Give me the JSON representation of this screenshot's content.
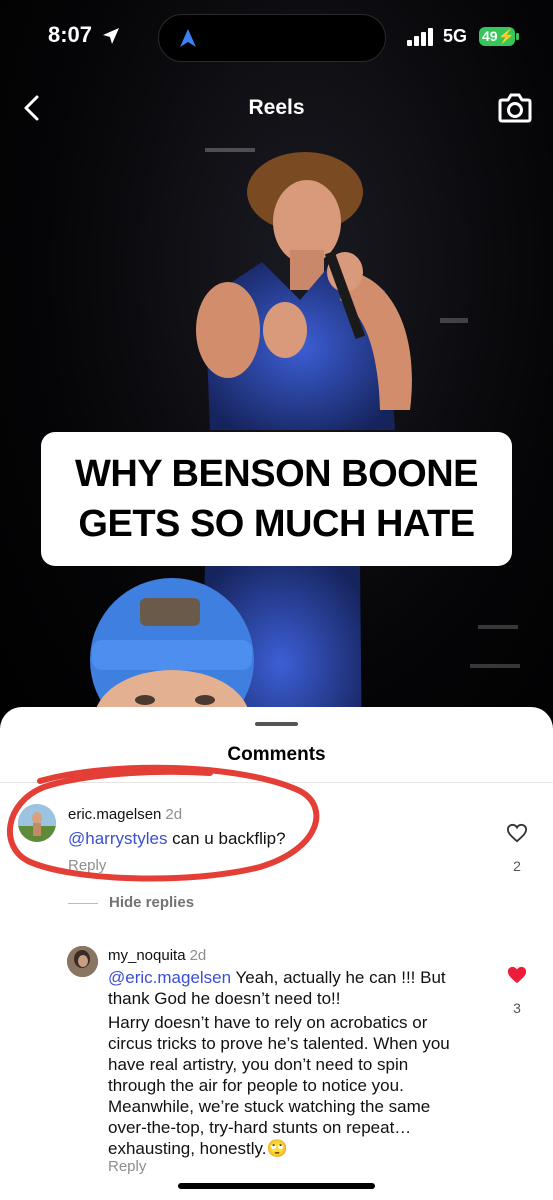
{
  "status_bar": {
    "time": "8:07",
    "network": "5G",
    "battery": "49"
  },
  "header": {
    "title": "Reels"
  },
  "video": {
    "caption_line1": "WHY BENSON BOONE",
    "caption_line2": "GETS SO MUCH HATE"
  },
  "comments_sheet": {
    "title": "Comments",
    "comments": [
      {
        "username": "eric.magelsen",
        "time": "2d",
        "mention": "@harrystyles",
        "text": " can u backflip?",
        "reply_label": "Reply",
        "likes": "2",
        "liked": false
      }
    ],
    "hide_replies_label": "Hide replies",
    "replies": [
      {
        "username": "my_noquita",
        "time": "2d",
        "mention": "@eric.magelsen",
        "text_part1": " Yeah, actually he can !!! But thank God he doesn’t need to!!",
        "text_part2": "Harry doesn’t have to rely on acrobatics or circus tricks to prove he’s talented. When you have real artistry, you don’t need to spin through the air for people to notice you. Meanwhile, we’re stuck watching the same over-the-top, try-hard stunts on repeat… exhausting, honestly.",
        "emoji": "🙄",
        "reply_label": "Reply",
        "likes": "3",
        "liked": true
      }
    ]
  },
  "colors": {
    "mention": "#3a4fd0",
    "like_active": "#ed1c3a",
    "annotation": "#e0241b",
    "battery": "#35c759"
  }
}
